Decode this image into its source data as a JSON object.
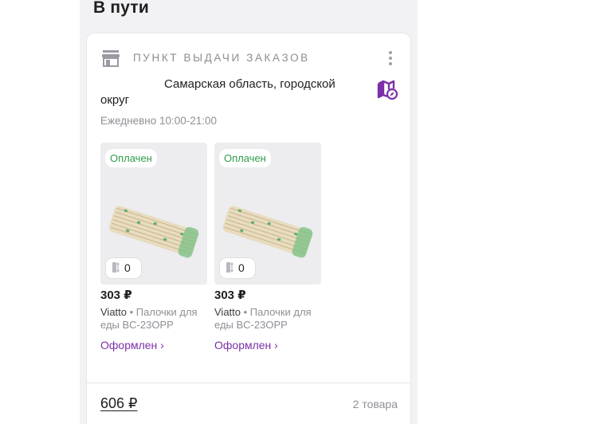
{
  "section": {
    "title": "В пути"
  },
  "card": {
    "header_title": "ПУНКТ ВЫДАЧИ ЗАКАЗОВ",
    "address_line1": "Самарская область, городской",
    "address_line2": "округ",
    "hours": "Ежедневно 10:00-21:00",
    "products": [
      {
        "status": "Оплачен",
        "quantity": "0",
        "price": "303 ₽",
        "brand": "Viatto",
        "separator": " • ",
        "name": "Палочки для еды BC-23OPP",
        "link": "Оформлен ›"
      },
      {
        "status": "Оплачен",
        "quantity": "0",
        "price": "303 ₽",
        "brand": "Viatto",
        "separator": " • ",
        "name": "Палочки для еды BC-23OPP",
        "link": "Оформлен ›"
      }
    ],
    "total": "606 ₽",
    "items_count": "2 товара"
  },
  "colors": {
    "accent": "#7c2fa8",
    "paid_green": "#2f9b4b",
    "muted": "#8f8f96",
    "panel_bg": "#f2f2f5"
  },
  "icons": {
    "store": "store-icon",
    "menu": "more-vertical-icon",
    "map": "map-compass-icon",
    "quantity": "quantity-icon"
  }
}
